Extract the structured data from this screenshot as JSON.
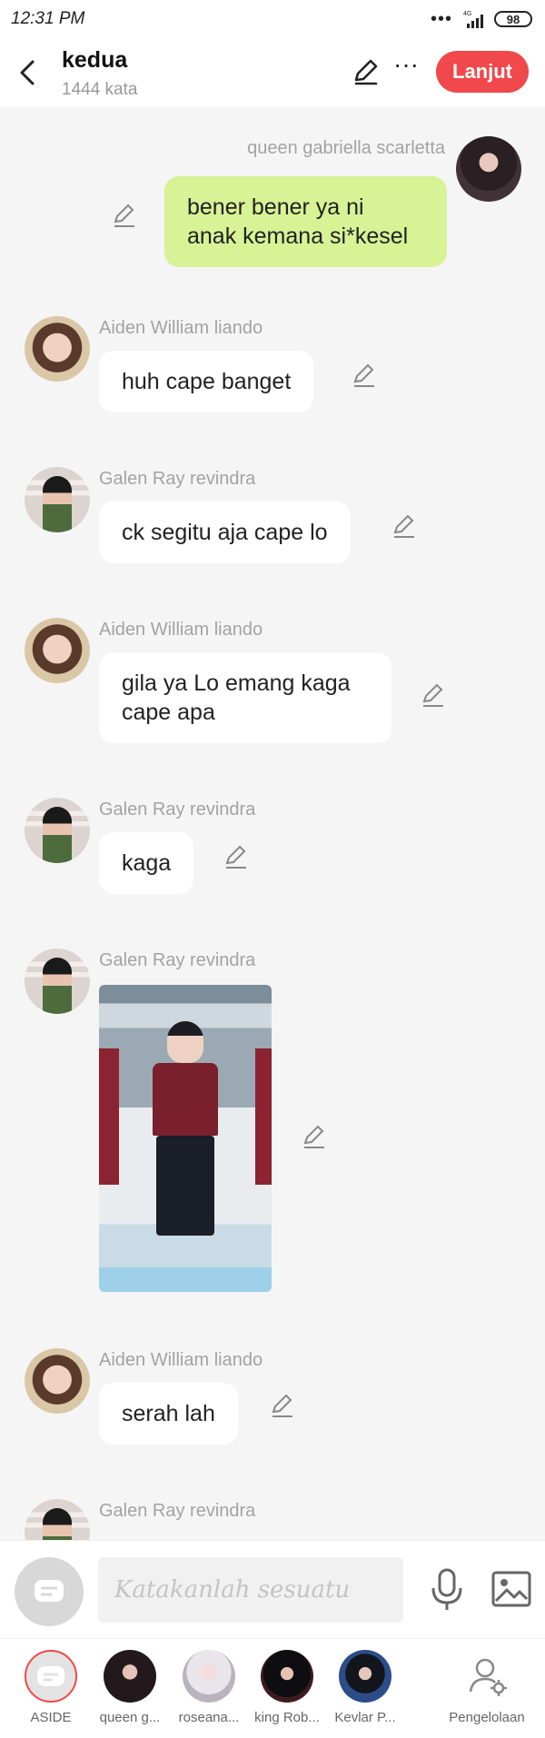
{
  "status_bar": {
    "time": "12:31 PM",
    "network": "4G",
    "battery": "98"
  },
  "header": {
    "title": "kedua",
    "word_count": "1444 kata",
    "next_label": "Lanjut"
  },
  "messages": [
    {
      "sender": "queen gabriella scarletta",
      "text": "bener bener ya ni\nanak kemana si*kesel",
      "side": "right"
    },
    {
      "sender": "Aiden William liando",
      "text": "huh cape banget",
      "side": "left"
    },
    {
      "sender": "Galen Ray revindra",
      "text": "ck segitu aja cape lo",
      "side": "left"
    },
    {
      "sender": "Aiden William liando",
      "text": "gila ya Lo emang kaga\ncape apa",
      "side": "left"
    },
    {
      "sender": "Galen Ray revindra",
      "text": "kaga",
      "side": "left"
    },
    {
      "sender": "Galen Ray revindra",
      "type": "image",
      "side": "left"
    },
    {
      "sender": "Aiden William liando",
      "text": "serah lah",
      "side": "left"
    },
    {
      "sender": "Galen Ray revindra",
      "side": "left"
    }
  ],
  "composer": {
    "placeholder": "Katakanlah sesuatu"
  },
  "bottom_tabs": [
    {
      "label": "ASIDE",
      "active": true
    },
    {
      "label": "queen g..."
    },
    {
      "label": "roseana..."
    },
    {
      "label": "king Rob..."
    },
    {
      "label": "Kevlar P..."
    },
    {
      "label": "Pengelolaan"
    }
  ],
  "colors": {
    "accent": "#f0484b",
    "my_bubble": "#d7f396",
    "background": "#f5f5f5"
  }
}
